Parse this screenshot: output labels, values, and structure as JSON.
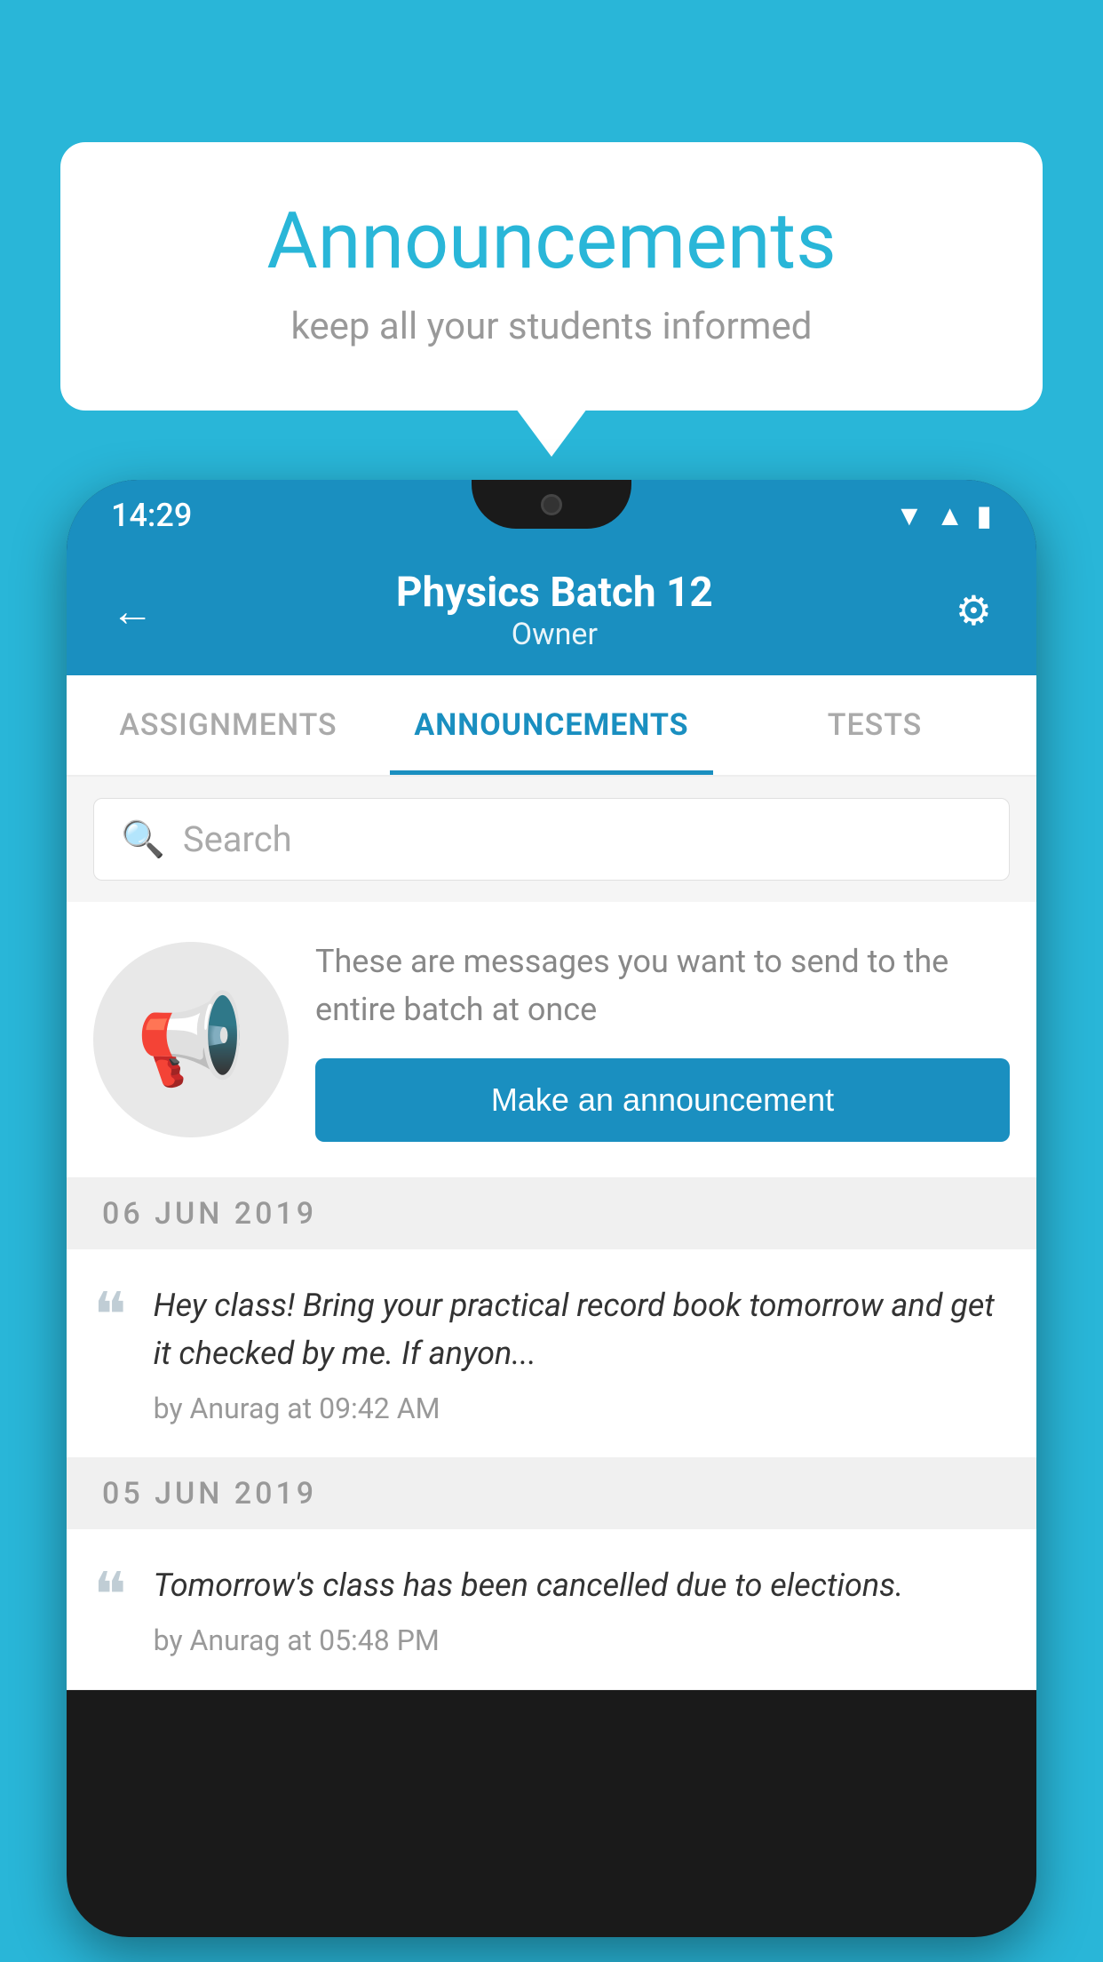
{
  "background_color": "#29b6d8",
  "speech_bubble": {
    "title": "Announcements",
    "subtitle": "keep all your students informed"
  },
  "phone": {
    "status_bar": {
      "time": "14:29"
    },
    "header": {
      "back_label": "←",
      "title": "Physics Batch 12",
      "subtitle": "Owner",
      "settings_label": "⚙"
    },
    "tabs": [
      {
        "label": "ASSIGNMENTS",
        "active": false
      },
      {
        "label": "ANNOUNCEMENTS",
        "active": true
      },
      {
        "label": "TESTS",
        "active": false
      }
    ],
    "search": {
      "placeholder": "Search"
    },
    "promo": {
      "description": "These are messages you want to send to the entire batch at once",
      "button_label": "Make an announcement"
    },
    "announcements": [
      {
        "date": "06  JUN  2019",
        "message": "Hey class! Bring your practical record book tomorrow and get it checked by me. If anyon...",
        "meta": "by Anurag at 09:42 AM"
      },
      {
        "date": "05  JUN  2019",
        "message": "Tomorrow's class has been cancelled due to elections.",
        "meta": "by Anurag at 05:48 PM"
      }
    ]
  }
}
